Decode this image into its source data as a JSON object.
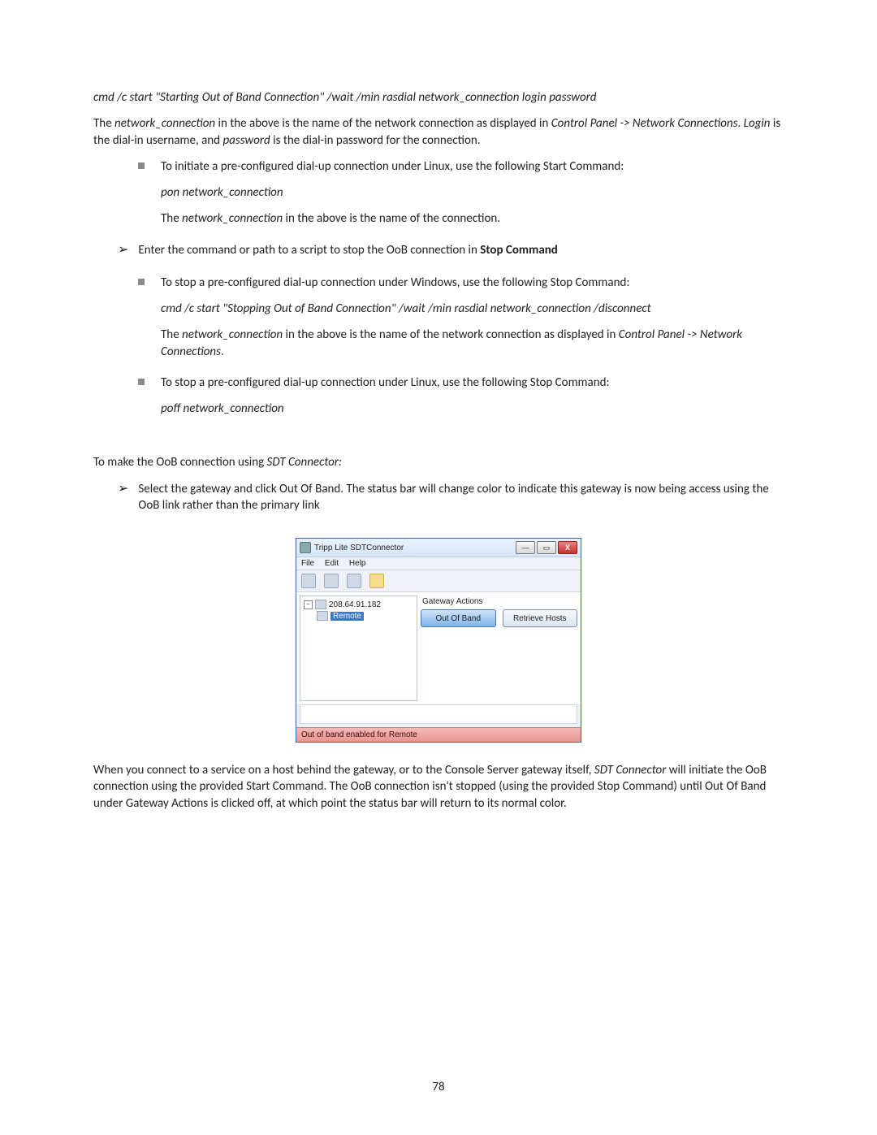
{
  "cmd1": "cmd /c start \"Starting Out of Band Connection\" /wait /min rasdial network_connection login password",
  "p1_a": "The ",
  "p1_b": "network_connection",
  "p1_c": " in the above is the name of the network connection as displayed in ",
  "p1_d": "Control Panel -> Network Connections",
  "p1_e": ". ",
  "p1_f": "Login",
  "p1_g": " is the dial-in username, and ",
  "p1_h": "password",
  "p1_i": " is the dial-in password for the connection.",
  "b1": "To initiate a pre-configured dial-up connection under Linux, use the following Start Command:",
  "cmd2": "pon network_connection",
  "p2_a": "The ",
  "p2_b": "network_connection",
  "p2_c": " in the above is the name of the connection.",
  "arrow1_a": "Enter the command or path to a script to stop the OoB connection in ",
  "arrow1_b": "Stop Command",
  "b2": "To stop a pre-configured dial-up connection under Windows, use the following Stop Command:",
  "cmd3": "cmd /c start \"Stopping Out of Band Connection\" /wait /min rasdial network_connection /disconnect",
  "p3_a": "The ",
  "p3_b": "network_connection",
  "p3_c": " in the above is the name of the network connection as displayed in ",
  "p3_d": "Control Panel -> Network Connections",
  "p3_e": ".",
  "b3": "To stop a pre-configured dial-up connection under Linux, use the following Stop Command:",
  "cmd4": "poff network_connection",
  "p4_a": "To make the OoB connection using ",
  "p4_b": "SDT Connector:",
  "arrow2": "Select the gateway and click Out Of Band. The status bar will change color to indicate this gateway is now being access using the OoB link rather than the primary link",
  "win": {
    "title": "Tripp Lite SDTConnector",
    "menu_file": "File",
    "menu_edit": "Edit",
    "menu_help": "Help",
    "tree_ip": "208.64.91.182",
    "tree_remote": "Remote",
    "ga_label": "Gateway Actions",
    "btn_oob": "Out Of Band",
    "btn_retrieve": "Retrieve Hosts",
    "status": "Out of band enabled for Remote"
  },
  "p5_a": "When you connect to a service on a host behind the gateway, or to the Console Server gateway itself, ",
  "p5_b": "SDT Connector",
  "p5_c": " will initiate the OoB connection using the provided Start Command. The OoB connection isn't stopped (using the provided Stop Command) until Out Of Band under Gateway Actions is clicked off, at which point the status bar will return to its normal color.",
  "pagenum": "78"
}
